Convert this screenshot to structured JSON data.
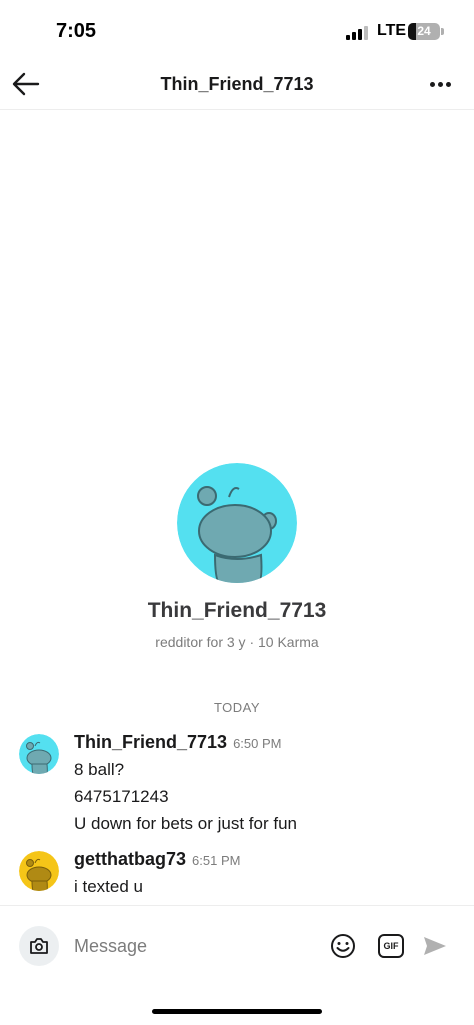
{
  "status_bar": {
    "time": "7:05",
    "network": "LTE",
    "battery_level": "24",
    "battery_fraction": 0.24,
    "signal_bars_active": 3,
    "signal_bars_total": 4
  },
  "header": {
    "title": "Thin_Friend_7713",
    "back_icon": "arrow-left-icon",
    "more_icon": "more-horizontal-icon"
  },
  "profile": {
    "username": "Thin_Friend_7713",
    "meta": "redditor for 3 y · 10 Karma",
    "avatar_color": "#54e0f0",
    "avatar_icon": "snoo-avatar-icon"
  },
  "date_divider": "TODAY",
  "messages": [
    {
      "author": "Thin_Friend_7713",
      "time": "6:50 PM",
      "avatar_color": "#54e0f0",
      "lines": [
        "8 ball?",
        "6475171243",
        "U down for bets or just for fun"
      ]
    },
    {
      "author": "getthatbag73",
      "time": "6:51 PM",
      "avatar_color": "#f5c518",
      "lines": [
        "i texted u"
      ]
    }
  ],
  "composer": {
    "placeholder": "Message",
    "gif_label": "GIF",
    "camera_icon": "camera-icon",
    "emoji_icon": "smiley-icon",
    "send_icon": "send-icon"
  },
  "colors": {
    "text_primary": "#1a1a1b",
    "text_secondary": "#7c7c7c",
    "divider": "#ededed",
    "send_disabled": "#b0b0b0"
  }
}
